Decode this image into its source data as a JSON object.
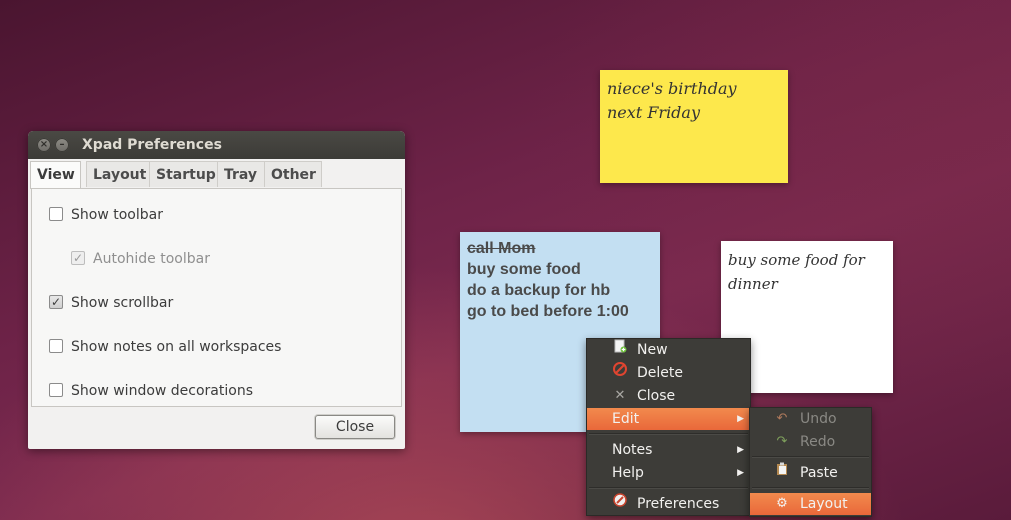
{
  "dialog": {
    "title": "Xpad Preferences",
    "tabs": [
      {
        "label": "View",
        "active": true
      },
      {
        "label": "Layout"
      },
      {
        "label": "Startup"
      },
      {
        "label": "Tray"
      },
      {
        "label": "Other"
      }
    ],
    "options": [
      {
        "label": "Show toolbar",
        "checked": false
      },
      {
        "label": "Autohide toolbar",
        "checked": true,
        "disabled": true
      },
      {
        "label": "Show scrollbar",
        "checked": true
      },
      {
        "label": "Show notes on all workspaces",
        "checked": false
      },
      {
        "label": "Show window decorations",
        "checked": false
      }
    ],
    "close_label": "Close"
  },
  "notes": {
    "yellow": {
      "lines": [
        "niece's birthday",
        "next Friday"
      ],
      "color": "#fde84c"
    },
    "white": {
      "lines": [
        "buy some food for",
        "dinner"
      ],
      "color": "#ffffff"
    },
    "blue": {
      "lines": [
        "call Mom",
        "buy some food",
        "do a backup for hb",
        "go to bed before 1:00"
      ],
      "color": "#c3dff2"
    }
  },
  "context_menu": {
    "items": [
      {
        "label": "New",
        "icon": "new-note-icon"
      },
      {
        "label": "Delete",
        "icon": "delete-icon"
      },
      {
        "label": "Close",
        "icon": "close-icon"
      },
      {
        "label": "Edit",
        "submenu": true,
        "highlighted": true
      },
      {
        "label": "Notes",
        "submenu": true
      },
      {
        "label": "Help",
        "submenu": true
      },
      {
        "label": "Preferences",
        "icon": "preferences-icon"
      }
    ],
    "highlight_color": "#ef7a45"
  },
  "edit_submenu": {
    "items": [
      {
        "label": "Undo",
        "icon": "undo-icon",
        "disabled": true
      },
      {
        "label": "Redo",
        "icon": "redo-icon",
        "disabled": true
      },
      {
        "label": "Paste",
        "icon": "paste-icon"
      },
      {
        "label": "Layout",
        "icon": "gear-icon",
        "highlighted": true
      }
    ]
  }
}
